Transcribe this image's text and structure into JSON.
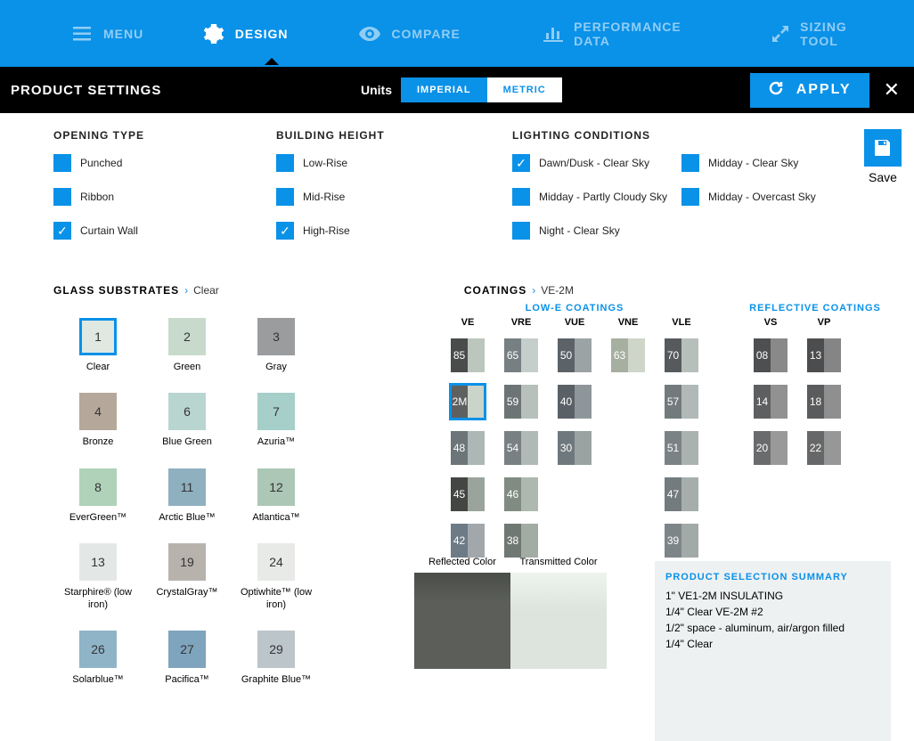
{
  "nav": {
    "menu": "MENU",
    "design": "DESIGN",
    "compare": "COMPARE",
    "performance": "PERFORMANCE DATA",
    "sizing": "SIZING TOOL"
  },
  "bar": {
    "title": "PRODUCT SETTINGS",
    "units_label": "Units",
    "imperial": "IMPERIAL",
    "metric": "METRIC",
    "apply": "APPLY"
  },
  "save": "Save",
  "settings": {
    "opening": {
      "title": "OPENING TYPE",
      "items": [
        {
          "label": "Punched",
          "checked": false
        },
        {
          "label": "Ribbon",
          "checked": false
        },
        {
          "label": "Curtain Wall",
          "checked": true
        }
      ]
    },
    "height": {
      "title": "BUILDING HEIGHT",
      "items": [
        {
          "label": "Low-Rise",
          "checked": false
        },
        {
          "label": "Mid-Rise",
          "checked": false
        },
        {
          "label": "High-Rise",
          "checked": true
        }
      ]
    },
    "lighting": {
      "title": "LIGHTING CONDITIONS",
      "col1": [
        {
          "label": "Dawn/Dusk - Clear Sky",
          "checked": true
        },
        {
          "label": "Midday - Partly Cloudy Sky",
          "checked": false
        },
        {
          "label": "Night - Clear Sky",
          "checked": false
        }
      ],
      "col2": [
        {
          "label": "Midday - Clear Sky",
          "checked": false
        },
        {
          "label": "Midday - Overcast Sky",
          "checked": false
        }
      ]
    }
  },
  "substrates": {
    "title": "GLASS SUBSTRATES",
    "selected": "Clear",
    "items": [
      {
        "num": "1",
        "name": "Clear",
        "color": "#dfe9e2",
        "selected": true
      },
      {
        "num": "2",
        "name": "Green",
        "color": "#c8dacc"
      },
      {
        "num": "3",
        "name": "Gray",
        "color": "#9a9c9e"
      },
      {
        "num": "4",
        "name": "Bronze",
        "color": "#b5a89b"
      },
      {
        "num": "6",
        "name": "Blue Green",
        "color": "#b9d5cf"
      },
      {
        "num": "7",
        "name": "Azuria™",
        "color": "#a6cfc9"
      },
      {
        "num": "8",
        "name": "EverGreen™",
        "color": "#b0d2b8"
      },
      {
        "num": "11",
        "name": "Arctic Blue™",
        "color": "#8fb1bf"
      },
      {
        "num": "12",
        "name": "Atlantica™",
        "color": "#acc7b5"
      },
      {
        "num": "13",
        "name": "Starphire® (low iron)",
        "color": "#e3e8e6"
      },
      {
        "num": "19",
        "name": "CrystalGray™",
        "color": "#b7b3ac"
      },
      {
        "num": "24",
        "name": "Optiwhite™ (low iron)",
        "color": "#e8eae7"
      },
      {
        "num": "26",
        "name": "Solarblue™",
        "color": "#8fb4c8"
      },
      {
        "num": "27",
        "name": "Pacifica™",
        "color": "#7fa4bd"
      },
      {
        "num": "29",
        "name": "Graphite Blue™",
        "color": "#bcc5c9"
      }
    ]
  },
  "coatings": {
    "title": "COATINGS",
    "selected": "VE-2M",
    "lowe_title": "LOW-E COATINGS",
    "refl_title": "REFLECTIVE COATINGS",
    "cols": {
      "VE": "VE",
      "VRE": "VRE",
      "VUE": "VUE",
      "VNE": "VNE",
      "VLE": "VLE",
      "VS": "VS",
      "VP": "VP"
    },
    "ve": [
      {
        "n": "85",
        "l": "#4a4c4c",
        "r": "#bcc6bd"
      },
      {
        "n": "2M",
        "l": "#5e6060",
        "r": "#cbd4cb",
        "selected": true
      },
      {
        "n": "48",
        "l": "#6c7578",
        "r": "#adb7b5"
      },
      {
        "n": "45",
        "l": "#444644",
        "r": "#9ba39d"
      },
      {
        "n": "42",
        "l": "#6d7b86",
        "r": "#a1a7ab"
      }
    ],
    "vre": [
      {
        "n": "65",
        "l": "#767f82",
        "r": "#c5ceca"
      },
      {
        "n": "59",
        "l": "#6c7476",
        "r": "#b7c0bb"
      },
      {
        "n": "54",
        "l": "#788084",
        "r": "#b0b9b5"
      },
      {
        "n": "46",
        "l": "#808b82",
        "r": "#aeb8ae"
      },
      {
        "n": "38",
        "l": "#6f7873",
        "r": "#a2aca3"
      }
    ],
    "vue": [
      {
        "n": "50",
        "l": "#5b6268",
        "r": "#9ba3a4"
      },
      {
        "n": "40",
        "l": "#596066",
        "r": "#8e969a"
      },
      {
        "n": "30",
        "l": "#6f787c",
        "r": "#9aa3a2"
      }
    ],
    "vne": [
      {
        "n": "63",
        "l": "#a6afa0",
        "r": "#cfd6c9"
      }
    ],
    "vle": [
      {
        "n": "70",
        "l": "#565a5c",
        "r": "#b7bfbb"
      },
      {
        "n": "57",
        "l": "#727a7e",
        "r": "#b0b9b7"
      },
      {
        "n": "51",
        "l": "#7a8286",
        "r": "#aab2b0"
      },
      {
        "n": "47",
        "l": "#737b7f",
        "r": "#a6aeac"
      },
      {
        "n": "39",
        "l": "#7d8589",
        "r": "#a2aaa8"
      }
    ],
    "vs": [
      {
        "n": "08",
        "l": "#4e4f50",
        "r": "#888988"
      },
      {
        "n": "14",
        "l": "#5e5f60",
        "r": "#909190"
      },
      {
        "n": "20",
        "l": "#6a6b6c",
        "r": "#989998"
      }
    ],
    "vp": [
      {
        "n": "13",
        "l": "#4c4d4e",
        "r": "#848584"
      },
      {
        "n": "18",
        "l": "#5a5b5c",
        "r": "#8e8f8e"
      },
      {
        "n": "22",
        "l": "#666768",
        "r": "#969796"
      }
    ]
  },
  "preview": {
    "reflected": "Reflected Color",
    "transmitted": "Transmitted Color",
    "reflected_color": "#5b5e59",
    "transmitted_color": "#dde4de"
  },
  "summary": {
    "title": "PRODUCT SELECTION SUMMARY",
    "lines": [
      "1\" VE1-2M INSULATING",
      "1/4\" Clear VE-2M #2",
      "1/2\" space - aluminum, air/argon filled",
      "1/4\" Clear"
    ]
  }
}
